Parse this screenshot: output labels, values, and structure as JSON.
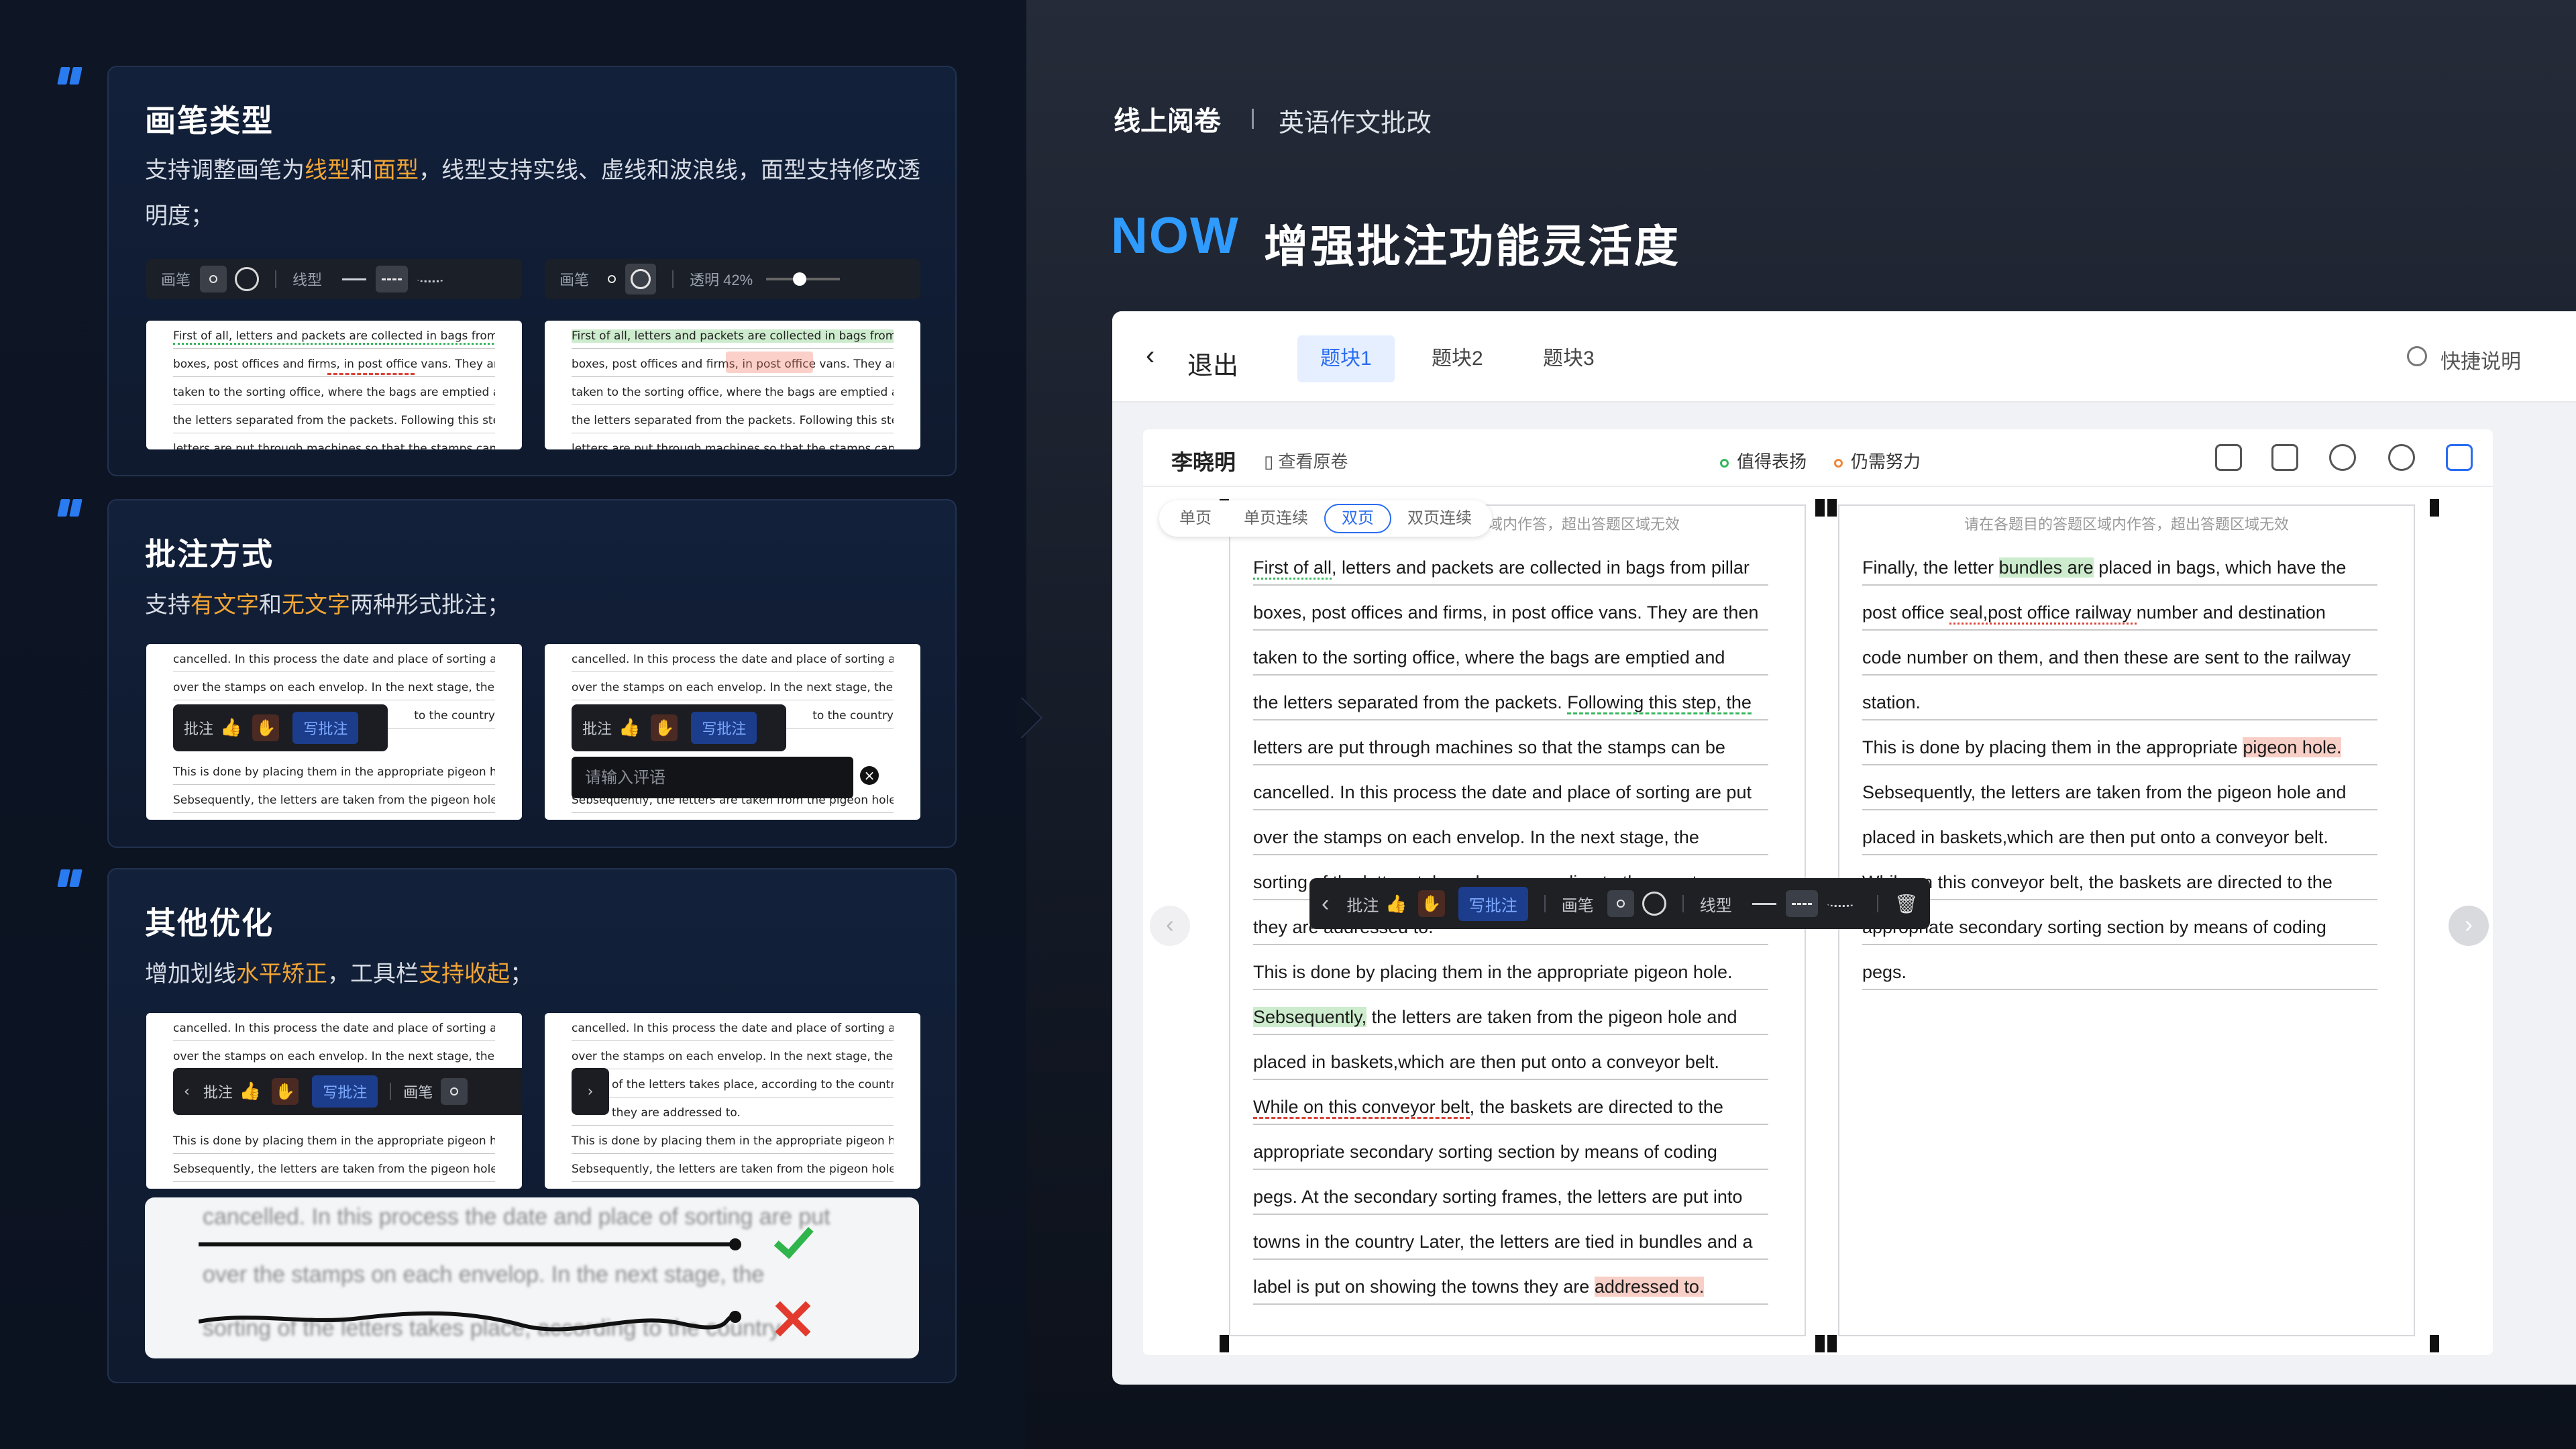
{
  "left": {
    "card1": {
      "title": "画笔类型",
      "desc_a": "支持调整画笔为",
      "desc_hl1": "线型",
      "desc_b": "和",
      "desc_hl2": "面型",
      "desc_c": "，线型支持实线、虚线和波浪线，面型支持修改透明度；",
      "tb1": {
        "pen": "画笔",
        "line": "线型"
      },
      "tb2": {
        "pen": "画笔",
        "opacity": "透明 42%"
      },
      "paper_lines": [
        "First of all, letters and packets are collected in bags from pillar",
        "boxes, post offices and firms, in post office vans. They are then",
        "taken to the sorting office, where the bags are emptied and",
        "the letters separated from the packets. Following this step, the",
        "letters are put through machines so that the stamps can be"
      ]
    },
    "card2": {
      "title": "批注方式",
      "desc_a": "支持",
      "desc_hl1": "有文字",
      "desc_b": "和",
      "desc_hl2": "无文字",
      "desc_c": "两种形式批注；",
      "popup": {
        "label": "批注",
        "write": "写批注"
      },
      "input_placeholder": "请输入评语",
      "paper_lines": [
        "cancelled. In this process the date and place of sorting are put",
        "over the stamps on each envelop. In the next stage, the",
        "of the letters takes place, according to the country",
        "they are addressed to.",
        "This is done by placing them in the appropriate pigeon hole.",
        "Sebsequently, the letters are taken from the pigeon hole and",
        "placed in baskets,which are then put onto a conveyor belt."
      ],
      "tail1": "to the country"
    },
    "card3": {
      "title": "其他优化",
      "desc_a": "增加划线",
      "desc_hl1": "水平矫正",
      "desc_b": "，工具栏",
      "desc_hl2": "支持收起",
      "desc_c": "；",
      "popup": {
        "label": "批注",
        "write": "写批注",
        "pen": "画笔"
      },
      "blur_lines": [
        "cancelled. In this process the date and place of sorting are put",
        "over the stamps on each envelop. In the next stage, the",
        "sorting of the letters takes place, according to the country"
      ]
    }
  },
  "right": {
    "breadcrumb": "线上阅卷",
    "breadcrumb_sub": "英语作文批改",
    "now": "NOW",
    "headline": "增强批注功能灵活度",
    "app": {
      "back": "退出",
      "tabs": [
        "题块1",
        "题块2",
        "题块3"
      ],
      "help": "快捷说明",
      "student": "李晓明",
      "view_source": "查看原卷",
      "legend_good": "值得表扬",
      "legend_work": "仍需努力",
      "modes": [
        "单页",
        "单页连续",
        "双页",
        "双页连续"
      ],
      "hint_left": "请在各题目的答题区域内作答，超出答题区域无效",
      "hint_right": "请在各题目的答题区域内作答，超出答题区域无效",
      "left_page": [
        "First of all, letters and packets are collected in bags from pillar",
        "boxes, post offices and firms, in post office vans. They are then",
        "taken to the sorting office, where the bags are emptied and",
        "the letters separated from the packets. Following this step, the",
        "letters are put through machines so that the stamps can be",
        "cancelled. In this process the date and place of sorting are put",
        "over the stamps on each envelop. In the next stage, the",
        "sorting of the letters takes place, according to the country",
        "they are addressed to.",
        "This is done by placing them in the appropriate pigeon hole.",
        "Sebsequently, the letters are taken from the pigeon hole and",
        "placed in baskets,which are then put onto a conveyor belt.",
        "While on this conveyor belt, the baskets are directed to the",
        "appropriate secondary sorting section by means of coding",
        "pegs. At the secondary sorting frames, the letters are put into",
        "towns in the country Later, the letters are tied in bundles and a",
        "label is put on showing the towns they are addressed to."
      ],
      "right_page": [
        "Finally, the letter bundles are placed in bags, which have the",
        "post office seal,post office railway number and destination",
        "code number on them, and then these are sent to the railway",
        "station.",
        "This is done by placing them in the appropriate pigeon hole.",
        "Sebsequently, the letters are taken from the pigeon hole and",
        "placed in baskets,which are then put onto a conveyor belt.",
        "While on this conveyor belt, the baskets are directed to the",
        "appropriate secondary sorting section by means of coding",
        "pegs."
      ],
      "floatbar": {
        "annot": "批注",
        "write": "写批注",
        "pen": "画笔",
        "line": "线型"
      }
    }
  },
  "colors": {
    "accent": "#2f9bff",
    "highlight": "#f3a534",
    "good": "#37b65c",
    "work": "#f0883a"
  }
}
